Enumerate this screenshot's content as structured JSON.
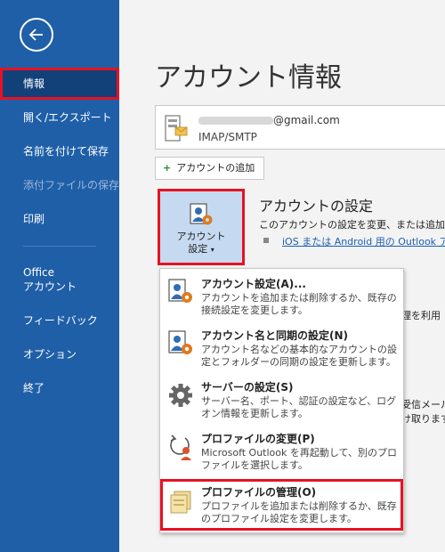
{
  "sidebar": {
    "items": [
      {
        "label": "情報",
        "active": true
      },
      {
        "label": "開く/エクスポート"
      },
      {
        "label": "名前を付けて保存"
      },
      {
        "label": "添付ファイルの保存",
        "disabled": true
      },
      {
        "label": "印刷"
      },
      {
        "label": "Office\nアカウント"
      },
      {
        "label": "フィードバック"
      },
      {
        "label": "オプション"
      },
      {
        "label": "終了"
      }
    ]
  },
  "main": {
    "title": "アカウント情報",
    "account": {
      "email_domain": "@gmail.com",
      "type": "IMAP/SMTP"
    },
    "add_account_label": "アカウントの追加",
    "settings_tile": {
      "line1": "アカウント",
      "line2": "設定"
    },
    "settings_heading": "アカウントの設定",
    "settings_desc": "このアカウントの設定を変更、または追加の接",
    "ios_link": "iOS または Android 用の Outlook ア",
    "partial_right": [
      "理を利用",
      "受信メール",
      "け取ります"
    ]
  },
  "dropdown": {
    "items": [
      {
        "title": "アカウント設定(A)...",
        "desc": "アカウントを追加または削除するか、既存の接続設定を変更します。",
        "icon": "account-settings-icon"
      },
      {
        "title": "アカウント名と同期の設定(N)",
        "desc": "アカウント名などの基本的なアカウントの設定とフォルダーの同期の設定を更新します。",
        "icon": "account-settings-icon"
      },
      {
        "title": "サーバーの設定(S)",
        "desc": "サーバー名、ポート、認証の設定など、ログオン情報を更新します。",
        "icon": "gear-icon"
      },
      {
        "title": "プロファイルの変更(P)",
        "desc": "Microsoft Outlook を再起動して、別のプロファイルを選択します。",
        "icon": "profile-change-icon"
      },
      {
        "title": "プロファイルの管理(O)",
        "desc": "プロファイルを追加または削除するか、既存のプロファイル設定を変更します。",
        "icon": "profile-manage-icon",
        "highlight": true
      }
    ]
  },
  "colors": {
    "sidebar": "#1f5fa8",
    "active": "#12417a",
    "highlight": "#e81123",
    "tile": "#c5daf0"
  }
}
